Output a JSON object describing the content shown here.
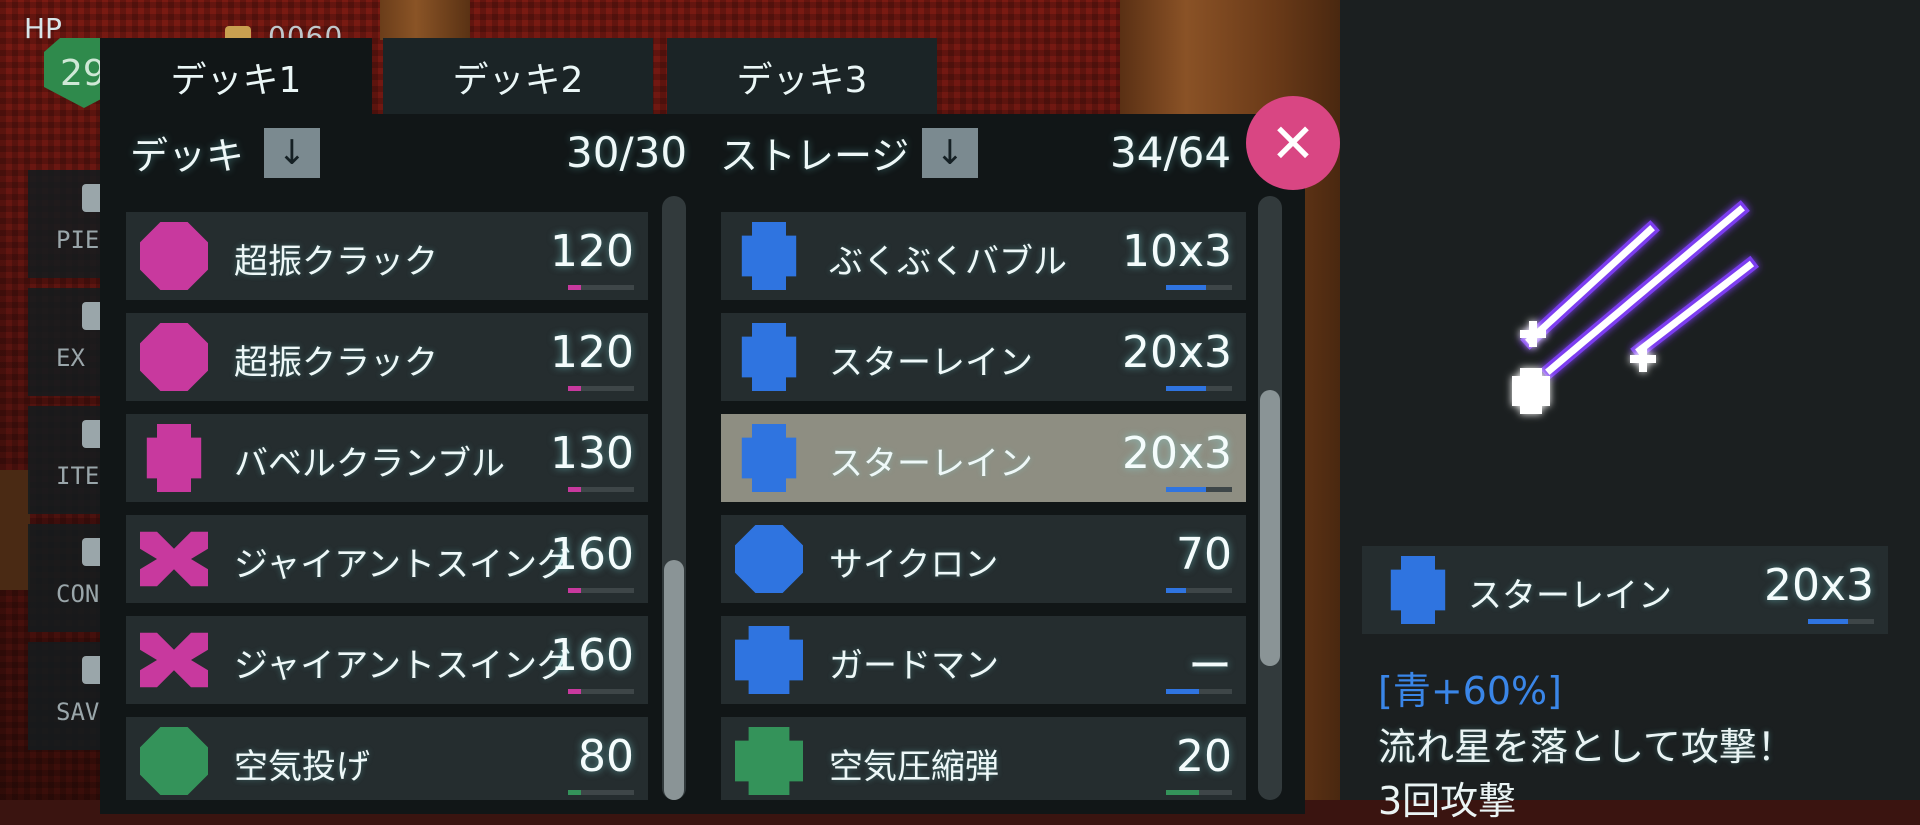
{
  "hud": {
    "hp_label": "HP",
    "hp_value": "29",
    "money": "0060"
  },
  "side_menu": [
    {
      "label": "PIE",
      "icon": "piece-icon"
    },
    {
      "label": "EX BO",
      "icon": "gear-icon"
    },
    {
      "label": "ITE",
      "icon": "item-icon"
    },
    {
      "label": "CONF",
      "icon": "config-icon"
    },
    {
      "label": "SAV",
      "icon": "save-icon"
    }
  ],
  "tabs": [
    {
      "label": "デッキ1"
    },
    {
      "label": "デッキ2"
    },
    {
      "label": "デッキ3"
    }
  ],
  "deck": {
    "title": "デッキ",
    "sort_icon": "↓",
    "count": "30/30",
    "rows": [
      {
        "name": "超振クラック",
        "value": "120",
        "shape": "octa",
        "color": "#c8399e",
        "meter": 0.2
      },
      {
        "name": "超振クラック",
        "value": "120",
        "shape": "octa",
        "color": "#c8399e",
        "meter": 0.2
      },
      {
        "name": "バベルクランブル",
        "value": "130",
        "shape": "tall",
        "color": "#c8399e",
        "meter": 0.2
      },
      {
        "name": "ジャイアントスイング",
        "value": "160",
        "shape": "x",
        "color": "#c8399e",
        "meter": 0.2
      },
      {
        "name": "ジャイアントスイング",
        "value": "160",
        "shape": "x",
        "color": "#c8399e",
        "meter": 0.2
      },
      {
        "name": "空気投げ",
        "value": "80",
        "shape": "octa",
        "color": "#34935a",
        "meter": 0.2
      }
    ]
  },
  "storage": {
    "title": "ストレージ",
    "sort_icon": "↓",
    "count": "34/64",
    "rows": [
      {
        "name": "ぶくぶくバブル",
        "value": "10x3",
        "shape": "tall",
        "color": "#2f74e0",
        "meter": 0.6
      },
      {
        "name": "スターレイン",
        "value": "20x3",
        "shape": "tall",
        "color": "#2f74e0",
        "meter": 0.6
      },
      {
        "name": "スターレイン",
        "value": "20x3",
        "shape": "tall",
        "color": "#2f74e0",
        "meter": 0.6
      },
      {
        "name": "サイクロン",
        "value": "70",
        "shape": "octa",
        "color": "#2f74e0",
        "meter": 0.3
      },
      {
        "name": "ガードマン",
        "value": "ー",
        "shape": "wide",
        "color": "#2f74e0",
        "meter": 0.5
      },
      {
        "name": "空気圧縮弾",
        "value": "20",
        "shape": "wide",
        "color": "#34935a",
        "meter": 0.5
      }
    ]
  },
  "detail": {
    "name": "スターレイン",
    "value": "20x3",
    "color": "#2f74e0",
    "meter": 0.6,
    "tag": "[青+60%]",
    "text": "流れ星を落として攻撃！",
    "text2": "3回攻撃"
  }
}
